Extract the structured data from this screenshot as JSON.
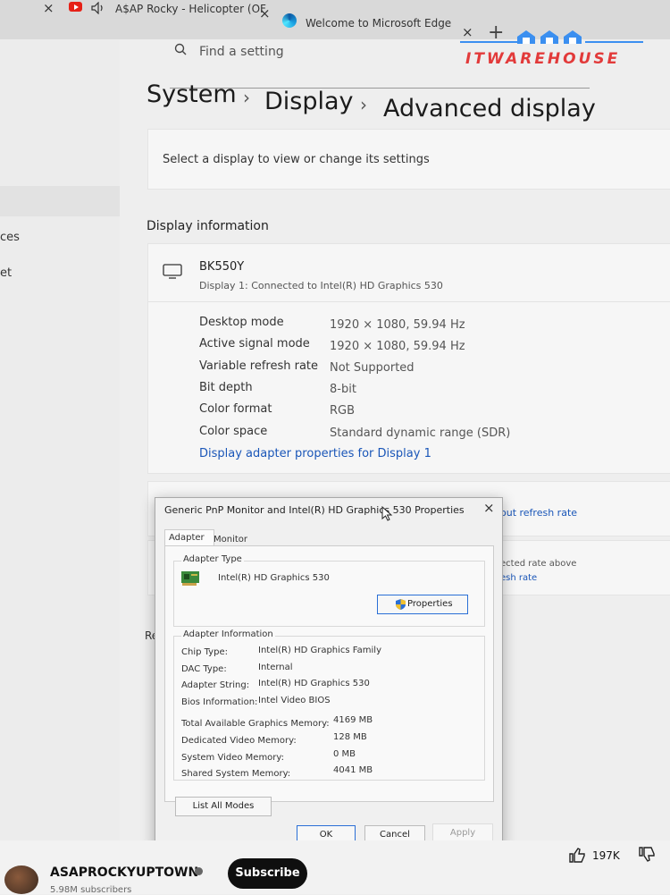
{
  "browser": {
    "tabs": [
      {
        "title": "A$AP Rocky - Helicopter (OF"
      },
      {
        "title": "Welcome to Microsoft Edge"
      }
    ],
    "close_glyph": "×",
    "new_tab_glyph": "+"
  },
  "watermark": {
    "text": "ITWAREHOUSE",
    "color": "#e23a3a",
    "accent": "#3b8ff0"
  },
  "left_nav": {
    "items": [
      "ces",
      "et"
    ]
  },
  "search": {
    "placeholder": "Find a setting"
  },
  "breadcrumb": {
    "items": [
      "System",
      "Display",
      "Advanced display"
    ],
    "separator": "›"
  },
  "select_display": {
    "text": "Select a display to view or change its settings"
  },
  "display_info": {
    "section_title": "Display information",
    "monitor_name": "BK550Y",
    "connection": "Display 1: Connected to Intel(R) HD Graphics 530",
    "rows": [
      {
        "label": "Desktop mode",
        "value": "1920 × 1080, 59.94 Hz"
      },
      {
        "label": "Active signal mode",
        "value": "1920 × 1080, 59.94 Hz"
      },
      {
        "label": "Variable refresh rate",
        "value": "Not Supported"
      },
      {
        "label": "Bit depth",
        "value": "8-bit"
      },
      {
        "label": "Color format",
        "value": "RGB"
      },
      {
        "label": "Color space",
        "value": "Standard dynamic range (SDR)"
      }
    ],
    "adapter_link": "Display adapter properties for Display 1"
  },
  "background_fragments": {
    "refresh_link": "out refresh rate",
    "rate_text": "ected rate above",
    "rate_link": "esh rate",
    "left_partial": "Re"
  },
  "dialog": {
    "title": "Generic PnP Monitor and Intel(R) HD Graphics 530 Properties",
    "tabs": [
      "Adapter",
      "Monitor"
    ],
    "adapter_type": {
      "legend": "Adapter Type",
      "name": "Intel(R) HD Graphics 530",
      "properties_button": "Properties"
    },
    "adapter_info": {
      "legend": "Adapter Information",
      "rows": [
        {
          "label": "Chip Type:",
          "value": "Intel(R) HD Graphics Family"
        },
        {
          "label": "DAC Type:",
          "value": "Internal"
        },
        {
          "label": "Adapter String:",
          "value": "Intel(R) HD Graphics 530"
        },
        {
          "label": "Bios Information:",
          "value": "Intel Video BIOS"
        }
      ],
      "memory": [
        {
          "label": "Total Available Graphics Memory:",
          "value": "4169 MB"
        },
        {
          "label": "Dedicated Video Memory:",
          "value": "128 MB"
        },
        {
          "label": "System Video Memory:",
          "value": "0 MB"
        },
        {
          "label": "Shared System Memory:",
          "value": "4041 MB"
        }
      ]
    },
    "list_all_modes": "List All Modes",
    "buttons": {
      "ok": "OK",
      "cancel": "Cancel",
      "apply": "Apply"
    }
  },
  "youtube": {
    "channel": "ASAPROCKYUPTOWN",
    "subscribers": "5.98M subscribers",
    "subscribe": "Subscribe",
    "likes": "197K"
  }
}
